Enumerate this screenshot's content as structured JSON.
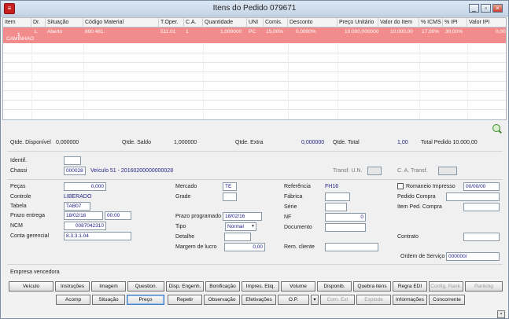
{
  "window": {
    "title": "Itens do Pedido 079671",
    "min": "_",
    "max": "▫",
    "close": "×"
  },
  "grid": {
    "headers": [
      "Item",
      "Dr.",
      "Situação",
      "Código Material",
      "T.Oper.",
      "C.A.",
      "Quantidade",
      "UNI",
      "Comis.",
      "Desconto",
      "Preço Unitário",
      "Valor do Item",
      "% ICMS",
      "% IPI",
      "Valor IPI"
    ],
    "row": {
      "item": "1",
      "dr": "L",
      "situacao": "Aberto",
      "codigo": "890.481.",
      "toper": "511.01",
      "ca": "1",
      "quantidade": "1,000000",
      "uni": "PC",
      "comis": "15,00%",
      "desconto": "0,0000%",
      "preco": "10.000,000000",
      "valor_item": "10.000,00",
      "icms": "17,00%",
      "ipi": "30,00%",
      "valor_ipi": "0,00",
      "descricao": "CAMINHAO"
    }
  },
  "summary": {
    "disponivel_label": "Qtde. Disponível",
    "disponivel": "0,000000",
    "saldo_label": "Qtde. Saldo",
    "saldo": "1,000000",
    "extra_label": "Qtde. Extra",
    "extra": "0,000000",
    "total_label": "Qtde. Total",
    "total": "1,00",
    "total_pedido": "Total Pedido 10.000,00"
  },
  "ident": {
    "identif_label": "Identif.",
    "identif": "",
    "chassi_label": "Chassi",
    "chassi_code": "000028",
    "chassi_desc": "Veículo 51 - 20160200000000028",
    "transf_un_label": "Transf. U.N.",
    "ca_transf_label": "C. A. Transf."
  },
  "fields": {
    "pecas_label": "Peças",
    "pecas": "0,000",
    "controle_label": "Controle",
    "controle": "LIBERADO",
    "tabela_label": "Tabela",
    "tabela": "TAB07",
    "prazo_entrega_label": "Prazo entrega",
    "prazo_entrega_data": "18/02/16",
    "prazo_entrega_hora": "00:00",
    "ncm_label": "NCM",
    "ncm": "0087042310",
    "conta_label": "Conta gerencial",
    "conta": "8.3.3.1.04",
    "mercado_label": "Mercado",
    "mercado": "TE",
    "grade_label": "Grade",
    "prazo_prog_label": "Prazo programado",
    "prazo_prog": "18/02/16",
    "tipo_label": "Tipo",
    "tipo": "Normal",
    "detalhe_label": "Detalhe",
    "margem_label": "Margem de lucro",
    "margem": "0,00",
    "referencia_label": "Referência",
    "referencia": "FH16",
    "fabrica_label": "Fábrica",
    "serie_label": "Série",
    "nf_label": "NF",
    "nf": "0",
    "documento_label": "Documento",
    "rem_cliente_label": "Rem. cliente",
    "romaneio_label": "Romaneio Impresso",
    "romaneio_data": "00/00/00",
    "pedido_compra_label": "Pedido Compra",
    "item_ped_label": "Item Ped. Compra",
    "contrato_label": "Contrato",
    "ordem_label": "Ordem de Serviço",
    "ordem": "000000/",
    "empresa_label": "Empresa vencedora"
  },
  "buttons_row1": [
    "Veículo",
    "Instruções",
    "Imagem",
    "Question.",
    "Disp. Engenh.",
    "Bonificação",
    "Impres. Etiq.",
    "Volume",
    "Disponib.",
    "Quebra itens",
    "Regra EDI",
    "Config. Rank.",
    "Ranking"
  ],
  "buttons_row2": [
    "Acomp",
    "Situação",
    "Preço",
    "Repetir",
    "Observação",
    "Efetivações",
    "O.P.",
    "▾",
    "Com. Ext",
    "Explode",
    "Informações",
    "Concorrente"
  ]
}
